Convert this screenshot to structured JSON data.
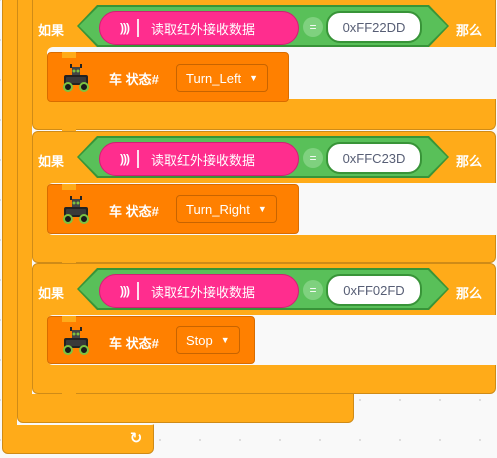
{
  "blocks": [
    {
      "if_label": "如果",
      "then_label": "那么",
      "reporter": "读取红外接收数据",
      "op": "=",
      "value": "0xFF22DD",
      "car_label": "车 状态#",
      "state": "Turn_Left"
    },
    {
      "if_label": "如果",
      "then_label": "那么",
      "reporter": "读取红外接收数据",
      "op": "=",
      "value": "0xFFC23D",
      "car_label": "车 状态#",
      "state": "Turn_Right"
    },
    {
      "if_label": "如果",
      "then_label": "那么",
      "reporter": "读取红外接收数据",
      "op": "=",
      "value": "0xFF02FD",
      "car_label": "车 状态#",
      "state": "Stop"
    }
  ],
  "icons": {
    "ir": "infrared-wave-icon",
    "car": "robot-car-icon",
    "loop": "loop-arrow-icon",
    "dropdown": "dropdown-caret-icon"
  },
  "colors": {
    "control": "#ffab19",
    "motor": "#ff8000",
    "operator": "#59c059",
    "ir_sensor": "#ff2d8e"
  }
}
